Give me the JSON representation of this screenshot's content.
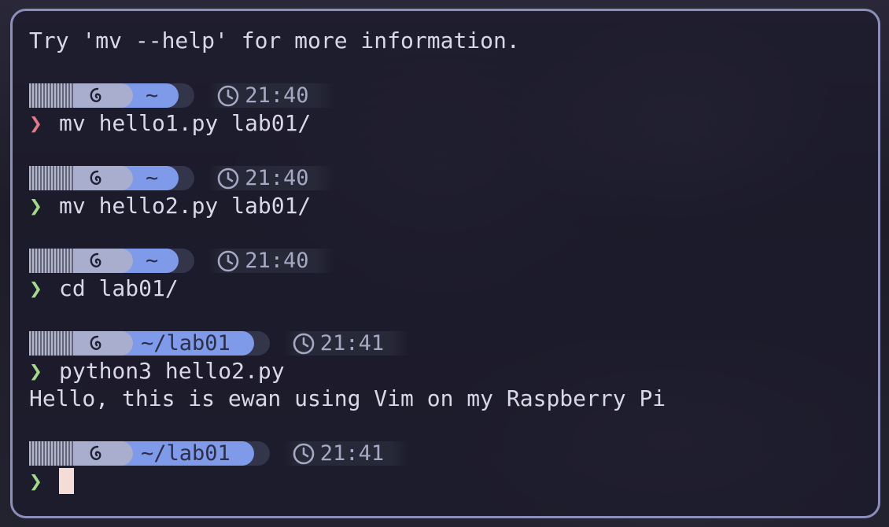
{
  "terminal": {
    "error_line": "Try 'mv --help' for more information.",
    "blocks": [
      {
        "dir": "~",
        "time": "21:40",
        "status": "err",
        "command": "mv hello1.py lab01/"
      },
      {
        "dir": "~",
        "time": "21:40",
        "status": "ok",
        "command": "mv hello2.py lab01/"
      },
      {
        "dir": "~",
        "time": "21:40",
        "status": "ok",
        "command": "cd lab01/"
      },
      {
        "dir": "~/lab01",
        "time": "21:41",
        "status": "ok",
        "command": "python3 hello2.py",
        "output": "Hello, this is ewan using Vim on my Raspberry Pi"
      },
      {
        "dir": "~/lab01",
        "time": "21:41",
        "status": "ok",
        "command": ""
      }
    ],
    "prompt_symbol": "❯",
    "os_icon": "debian-swirl-icon",
    "time_icon": "clock-icon"
  },
  "colors": {
    "window_border": "#8c8fbc",
    "dir_segment": "#7f9ae8",
    "os_segment": "#a9aece",
    "prompt_ok": "#a3d98c",
    "prompt_err": "#e07b8a",
    "cursor": "#f3ddd6"
  }
}
